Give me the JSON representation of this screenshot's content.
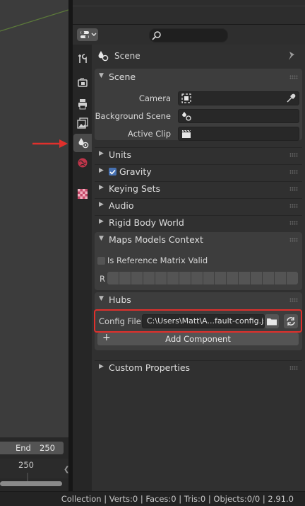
{
  "timeline": {
    "end_label": "End",
    "end_value": "250",
    "frame_marker": "250"
  },
  "header": {
    "editor_type_icon": "properties-editor-icon",
    "search_icon": "search-icon"
  },
  "tabs": [
    {
      "name": "tool",
      "icon": "wrench-screwdriver-icon"
    },
    {
      "name": "render",
      "icon": "camera-back-icon"
    },
    {
      "name": "output",
      "icon": "printer-icon"
    },
    {
      "name": "view-layer",
      "icon": "image-stack-icon"
    },
    {
      "name": "scene",
      "icon": "scene-icon",
      "active": true
    },
    {
      "name": "world",
      "icon": "globe-icon"
    },
    {
      "name": "texture",
      "icon": "checker-texture-icon"
    }
  ],
  "context": {
    "title": "Scene"
  },
  "scene_panel": {
    "title": "Scene",
    "camera_label": "Camera",
    "background_scene_label": "Background Scene",
    "active_clip_label": "Active Clip"
  },
  "collapsed_panels": {
    "units": "Units",
    "gravity": "Gravity",
    "keying_sets": "Keying Sets",
    "audio": "Audio",
    "rigid_body_world": "Rigid Body World"
  },
  "maps_panel": {
    "title": "Maps Models Context",
    "is_ref_matrix_label": "Is Reference Matrix Valid",
    "r_label": "R"
  },
  "hubs_panel": {
    "title": "Hubs",
    "config_label": "Config File:",
    "config_value": "C:\\Users\\Matt\\A...fault-config.json",
    "add_component_label": "Add Component"
  },
  "custom_props": {
    "title": "Custom Properties"
  },
  "status": {
    "text": "Collection | Verts:0 | Faces:0 | Tris:0 | Objects:0/0 | 2.91.0"
  },
  "colors": {
    "highlight": "#e0302c",
    "accent": "#4772b3"
  }
}
